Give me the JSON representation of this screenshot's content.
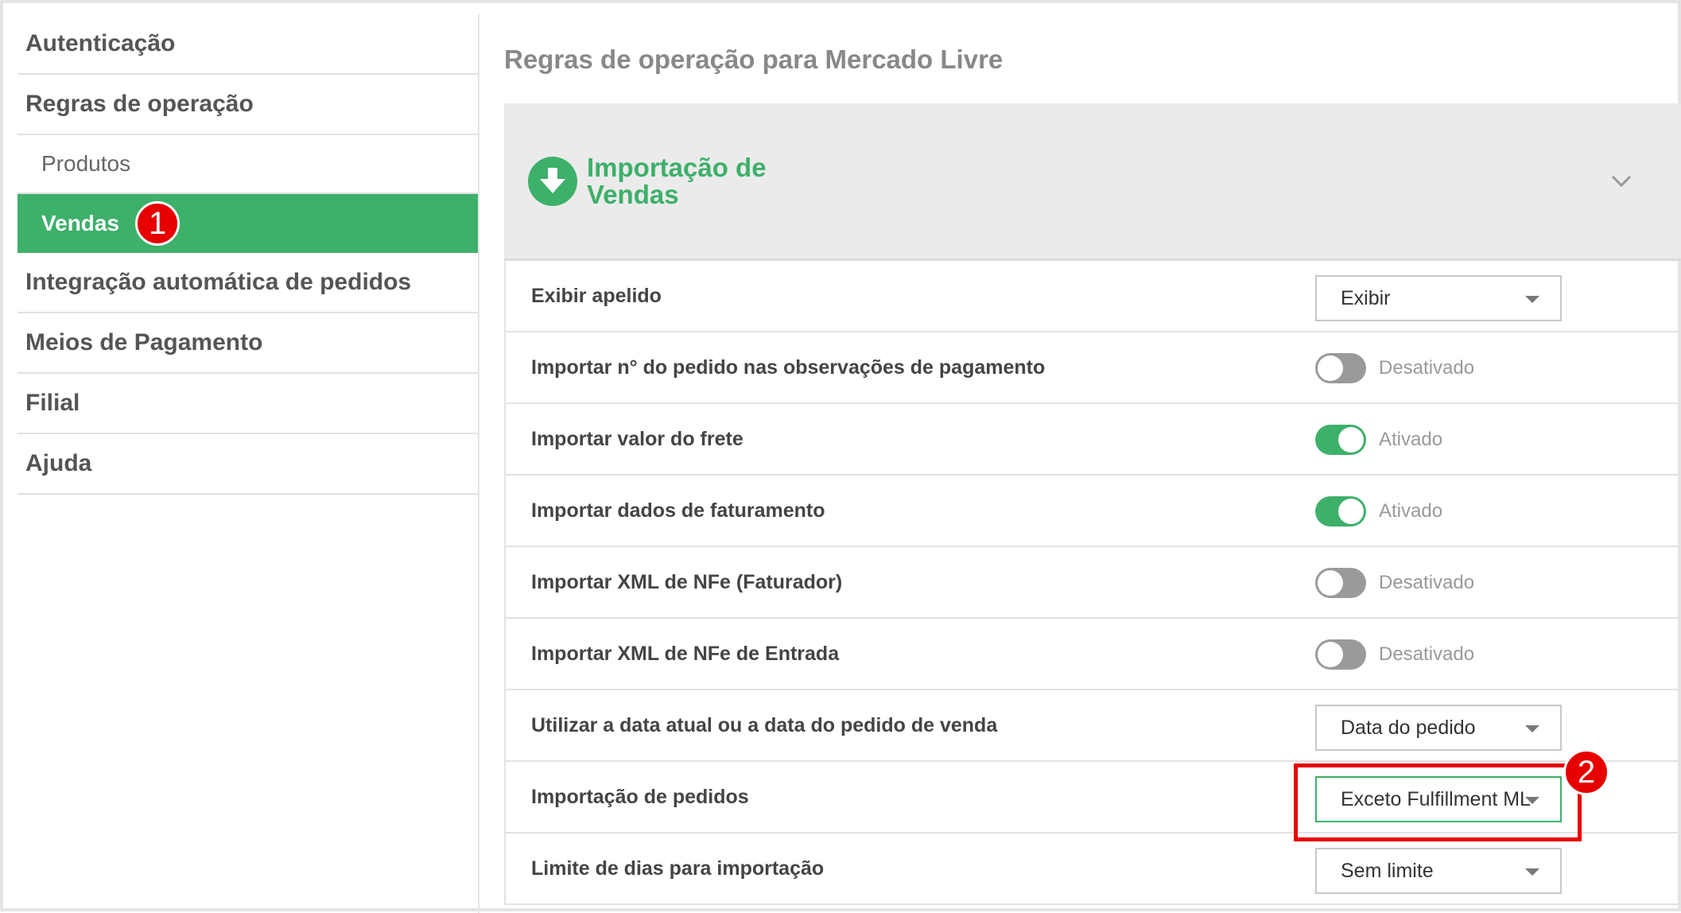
{
  "sidebar": {
    "items": [
      {
        "label": "Autenticação"
      },
      {
        "label": "Regras de operação"
      },
      {
        "label": "Produtos"
      },
      {
        "label": "Vendas"
      },
      {
        "label": "Integração automática de pedidos"
      },
      {
        "label": "Meios de Pagamento"
      },
      {
        "label": "Filial"
      },
      {
        "label": "Ajuda"
      }
    ],
    "active_badge": "1"
  },
  "main": {
    "page_title": "Regras de operação para Mercado Livre",
    "section": {
      "title": "Importação de Vendas",
      "icon": "download-circle-icon",
      "collapse_icon": "chevron-down-icon"
    },
    "rows": [
      {
        "label": "Exibir apelido",
        "control": "select",
        "value": "Exibir"
      },
      {
        "label": "Importar n° do pedido nas observações de pagamento",
        "control": "toggle",
        "on": false,
        "status": "Desativado"
      },
      {
        "label": "Importar valor do frete",
        "control": "toggle",
        "on": true,
        "status": "Ativado"
      },
      {
        "label": "Importar dados de faturamento",
        "control": "toggle",
        "on": true,
        "status": "Ativado"
      },
      {
        "label": "Importar XML de NFe (Faturador)",
        "control": "toggle",
        "on": false,
        "status": "Desativado"
      },
      {
        "label": "Importar XML de NFe de Entrada",
        "control": "toggle",
        "on": false,
        "status": "Desativado"
      },
      {
        "label": "Utilizar a data atual ou a data do pedido de venda",
        "control": "select",
        "value": "Data do pedido"
      },
      {
        "label": "Importação de pedidos",
        "control": "select",
        "value": "Exceto Fulfillment ML"
      },
      {
        "label": "Limite de dias para importação",
        "control": "select",
        "value": "Sem limite"
      }
    ],
    "highlight_badge": "2"
  },
  "colors": {
    "accent": "#3db06a",
    "annotation": "#e60000"
  }
}
